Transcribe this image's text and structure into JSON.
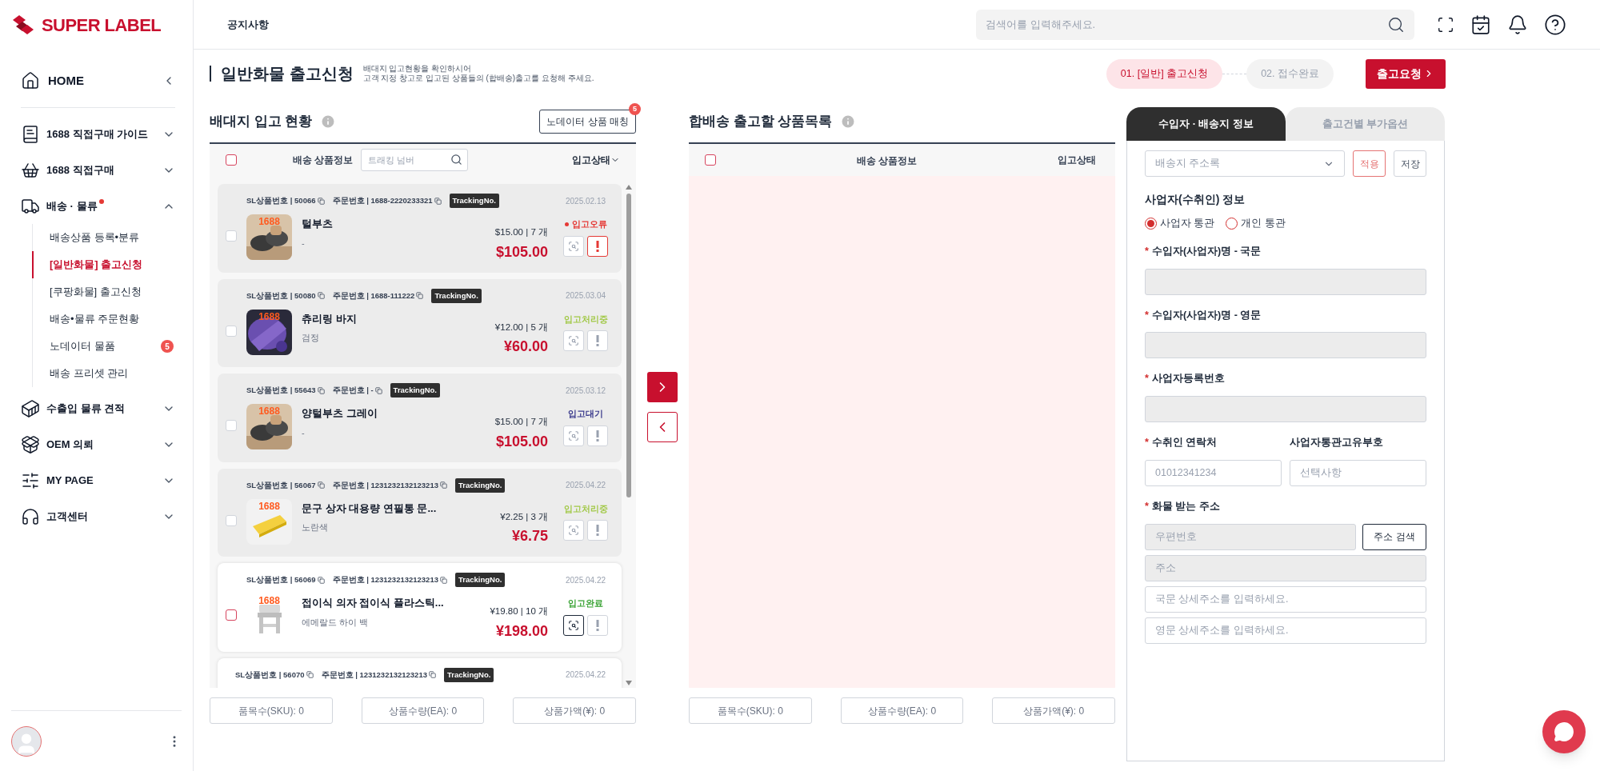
{
  "logo": {
    "text": "SUPER LABEL"
  },
  "sidebar": {
    "items": [
      {
        "label": "HOME",
        "kind": "home"
      },
      {
        "label": "1688 직접구매 가이드",
        "kind": "group",
        "expanded": false,
        "dot": false
      },
      {
        "label": "1688 직접구매",
        "kind": "group",
        "expanded": false,
        "dot": false
      },
      {
        "label": "배송 · 물류",
        "kind": "group",
        "expanded": true,
        "dot": true,
        "children": [
          {
            "label": "배송상품 등록•분류",
            "selected": false
          },
          {
            "label": "[일반화물] 출고신청",
            "selected": true
          },
          {
            "label": "[쿠팡화물] 출고신청",
            "selected": false
          },
          {
            "label": "배송•물류 주문현황",
            "selected": false
          },
          {
            "label": "노데이터 물품",
            "selected": false,
            "badge": "5"
          },
          {
            "label": "배송 프리셋 관리",
            "selected": false
          }
        ]
      },
      {
        "label": "수출입 물류 견적",
        "kind": "group",
        "expanded": false,
        "dot": false
      },
      {
        "label": "OEM 의뢰",
        "kind": "group",
        "expanded": false,
        "dot": false
      },
      {
        "label": "MY PAGE",
        "kind": "group",
        "expanded": false,
        "dot": false
      },
      {
        "label": "고객센터",
        "kind": "group",
        "expanded": false,
        "dot": false
      }
    ]
  },
  "header": {
    "notice_label": "공지사항",
    "search": {
      "placeholder": "검색어를 입력해주세요."
    }
  },
  "page": {
    "title": "일반화물 출고신청",
    "description": [
      "배대지 입고현황을 확인하시어",
      "고객 지정 창고로 입고된 상품들의 (합배송)출고를 요청해 주세요."
    ],
    "steps": [
      {
        "label": "01. [일반] 출고신청",
        "selected": true
      },
      {
        "label": "02. 접수완료",
        "selected": false
      }
    ],
    "submit": "출고요청"
  },
  "inbound": {
    "title": "배대지 입고 현황",
    "match_button": "노데이터 상품 매칭",
    "match_badge": "5",
    "product_column": "배송 상품정보",
    "status_column": "입고상태",
    "search_placeholder": "트래킹 넘버",
    "select_all": {
      "checked": false
    },
    "items": [
      {
        "sl_no": "SL상품번호 | 50066",
        "order_no": "주문번호 | 1688-2220233321",
        "tracking": "TrackingNo.",
        "date": "2025.02.13",
        "source": "1688",
        "name": "털부츠",
        "option": "-",
        "unit": "$15.00 | 7 개",
        "total": "$105.00",
        "status": "입고오류",
        "color": "#e53935",
        "disabled": true,
        "alert": true
      },
      {
        "sl_no": "SL상품번호 | 50080",
        "order_no": "주문번호 | 1688-111222",
        "tracking": "TrackingNo.",
        "date": "2025.03.04",
        "source": "1688",
        "name": "츄리링 바지",
        "option": "검정",
        "unit": "¥12.00 | 5 개",
        "total": "¥60.00",
        "status": "입고처리중",
        "color": "#a3c94a",
        "disabled": true,
        "alert": false
      },
      {
        "sl_no": "SL상품번호 | 55643",
        "order_no": "주문번호 | -",
        "tracking": "TrackingNo.",
        "date": "2025.03.12",
        "source": "1688",
        "name": "양털부츠 그레이",
        "option": "-",
        "unit": "$15.00 | 7 개",
        "total": "$105.00",
        "status": "입고대기",
        "color": "#3a3a8c",
        "disabled": true,
        "alert": false
      },
      {
        "sl_no": "SL상품번호 | 56067",
        "order_no": "주문번호 | 1231232132123213",
        "tracking": "TrackingNo.",
        "date": "2025.04.22",
        "source": "1688",
        "name": "문구 상자 대용량 연필통 문...",
        "option": "노란색",
        "unit": "¥2.25 | 3 개",
        "total": "¥6.75",
        "status": "입고처리중",
        "color": "#a3c94a",
        "disabled": true,
        "alert": false
      },
      {
        "sl_no": "SL상품번호 | 56069",
        "order_no": "주문번호 | 1231232132123213",
        "tracking": "TrackingNo.",
        "date": "2025.04.22",
        "source": "1688",
        "name": "접이식 의자 접이식 플라스틱...",
        "option": "에메랄드 하이 백",
        "unit": "¥19.80 | 10 개",
        "total": "¥198.00",
        "status": "입고완료",
        "color": "#3aa335",
        "disabled": false,
        "alert": false
      },
      {
        "sl_no": "SL상품번호 | 56070",
        "order_no": "주문번호 | 1231232132123213",
        "tracking": "TrackingNo.",
        "date": "2025.04.22"
      }
    ],
    "summary": [
      "품목수(SKU): 0",
      "상품수량(EA): 0",
      "상품가액(¥): 0"
    ]
  },
  "outbound": {
    "title": "합배송 출고할 상품목록",
    "select_all": {
      "checked": false
    },
    "product_column": "배송 상품정보",
    "status_column": "입고상태",
    "summary": [
      "품목수(SKU): 0",
      "상품수량(EA): 0",
      "상품가액(¥): 0"
    ]
  },
  "recipient": {
    "tabs": [
      {
        "label": "수입자 · 배송지 정보",
        "selected": true
      },
      {
        "label": "출고건별 부가옵션",
        "selected": false
      }
    ],
    "required_mark": "*",
    "address_book": {
      "placeholder": "배송지 주소록"
    },
    "apply": "적용",
    "save": "저장",
    "section_title": "사업자(수취인) 정보",
    "customs": [
      {
        "label": "사업자 통관",
        "selected": true
      },
      {
        "label": "개인 통관",
        "selected": false
      }
    ],
    "fields": [
      {
        "label": "수입자(사업자)명 - 국문",
        "required": true
      },
      {
        "label": "수입자(사업자)명 - 영문",
        "required": true
      },
      {
        "label": "사업자등록번호",
        "required": true
      }
    ],
    "contact": {
      "label": "수취인 연락처",
      "required": true,
      "placeholder": "01012341234"
    },
    "customs_code": {
      "label": "사업자통관고유부호",
      "required": false,
      "placeholder": "선택사항"
    },
    "address": {
      "label": "화물 받는 주소",
      "required": true,
      "zip_placeholder": "우편번호",
      "search_button": "주소 검색",
      "address_placeholder": "주소",
      "detail_ko_placeholder": "국문 상세주소를 입력하세요.",
      "detail_en_placeholder": "영문 상세주소를 입력하세요."
    }
  }
}
